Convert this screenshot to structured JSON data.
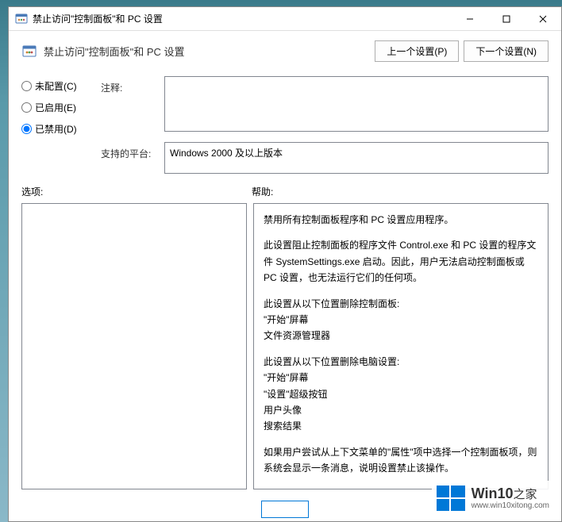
{
  "titlebar": {
    "title": "禁止访问\"控制面板\"和 PC 设置"
  },
  "header": {
    "title": "禁止访问\"控制面板\"和 PC 设置"
  },
  "nav": {
    "prev": "上一个设置(P)",
    "next": "下一个设置(N)"
  },
  "radios": {
    "not_configured": "未配置(C)",
    "enabled": "已启用(E)",
    "disabled": "已禁用(D)"
  },
  "labels": {
    "comment": "注释:",
    "supported": "支持的平台:",
    "options": "选项:",
    "help": "帮助:"
  },
  "supported_text": "Windows 2000 及以上版本",
  "help": {
    "p1": "禁用所有控制面板程序和 PC 设置应用程序。",
    "p2": "此设置阻止控制面板的程序文件 Control.exe 和 PC 设置的程序文件 SystemSettings.exe 启动。因此，用户无法启动控制面板或 PC 设置，也无法运行它们的任何项。",
    "p3": "此设置从以下位置删除控制面板:",
    "p3a": "\"开始\"屏幕",
    "p3b": "文件资源管理器",
    "p4": "此设置从以下位置删除电脑设置:",
    "p4a": "\"开始\"屏幕",
    "p4b": "\"设置\"超级按钮",
    "p4c": "用户头像",
    "p4d": "搜索结果",
    "p5": "如果用户尝试从上下文菜单的\"属性\"项中选择一个控制面板项，则系统会显示一条消息，说明设置禁止该操作。"
  },
  "watermark": {
    "brand": "Win10",
    "suffix": "之家",
    "url": "www.win10xitong.com"
  }
}
